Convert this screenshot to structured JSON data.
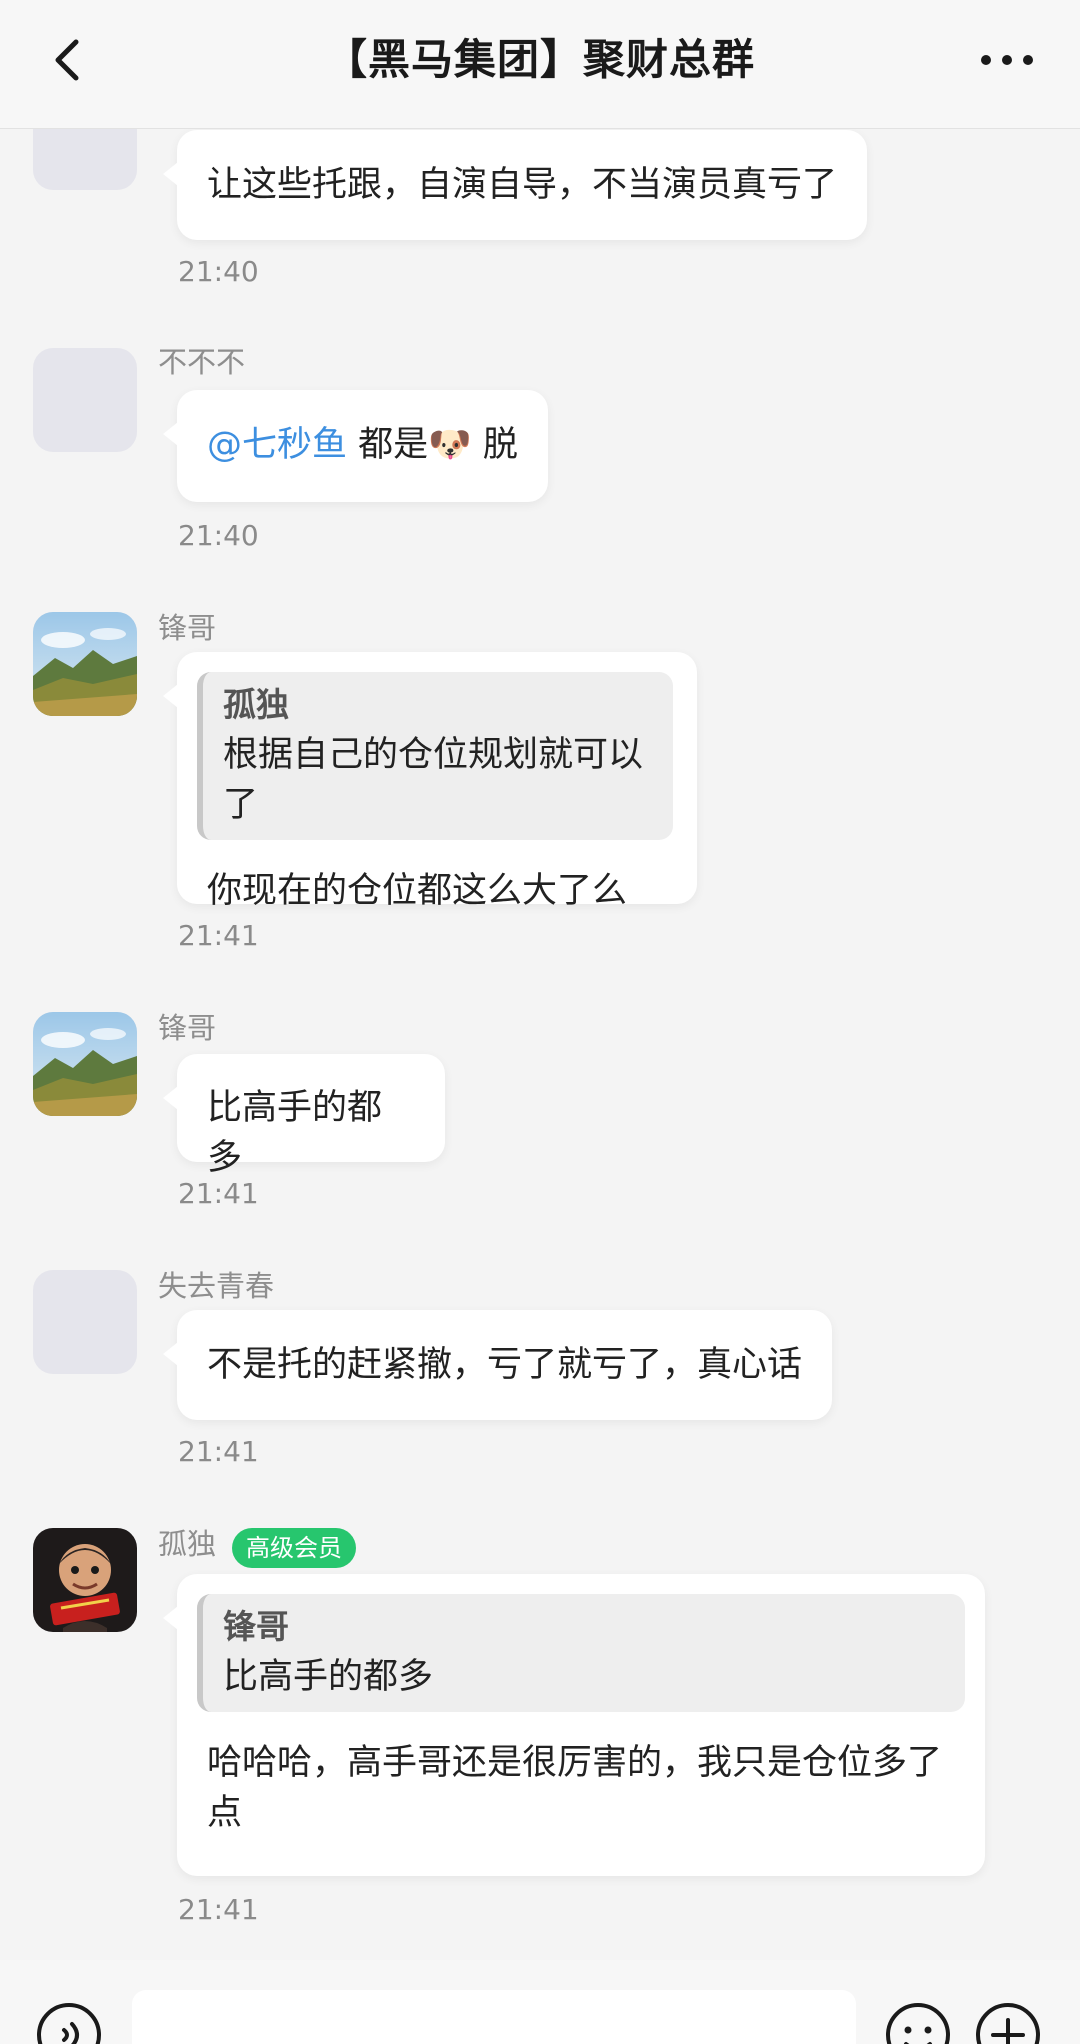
{
  "header": {
    "title": "【黑马集团】聚财总群",
    "back_icon": "chevron-left-icon",
    "more_icon": "more-horizontal-icon"
  },
  "messages": [
    {
      "sender": "",
      "text": "让这些托跟，自演自导，不当演员真亏了",
      "time": "21:40"
    },
    {
      "sender": "不不不",
      "mention": "@七秒鱼",
      "text_before": "都是",
      "emoji": "🐶",
      "text_after": "脱",
      "time": "21:40"
    },
    {
      "sender": "锋哥",
      "quote_name": "孤独",
      "quote_text": "根据自己的仓位规划就可以了",
      "text": "你现在的仓位都这么大了么",
      "time": "21:41"
    },
    {
      "sender": "锋哥",
      "text": "比高手的都多",
      "time": "21:41"
    },
    {
      "sender": "失去青春",
      "text": "不是托的赶紧撤，亏了就亏了，真心话",
      "time": "21:41"
    },
    {
      "sender": "孤独",
      "badge": "高级会员",
      "quote_name": "锋哥",
      "quote_text": "比高手的都多",
      "text_line1": "哈哈哈，高手哥还是很厉害的，我只是仓位多了",
      "text_line2": "点",
      "time": "21:41"
    }
  ],
  "input_bar": {
    "voice_icon": "voice-icon",
    "emoji_icon": "emoji-icon",
    "plus_icon": "plus-icon",
    "placeholder": ""
  },
  "colors": {
    "mention": "#3d8fe0",
    "badge": "#27c66e",
    "background": "#f4f4f4"
  }
}
